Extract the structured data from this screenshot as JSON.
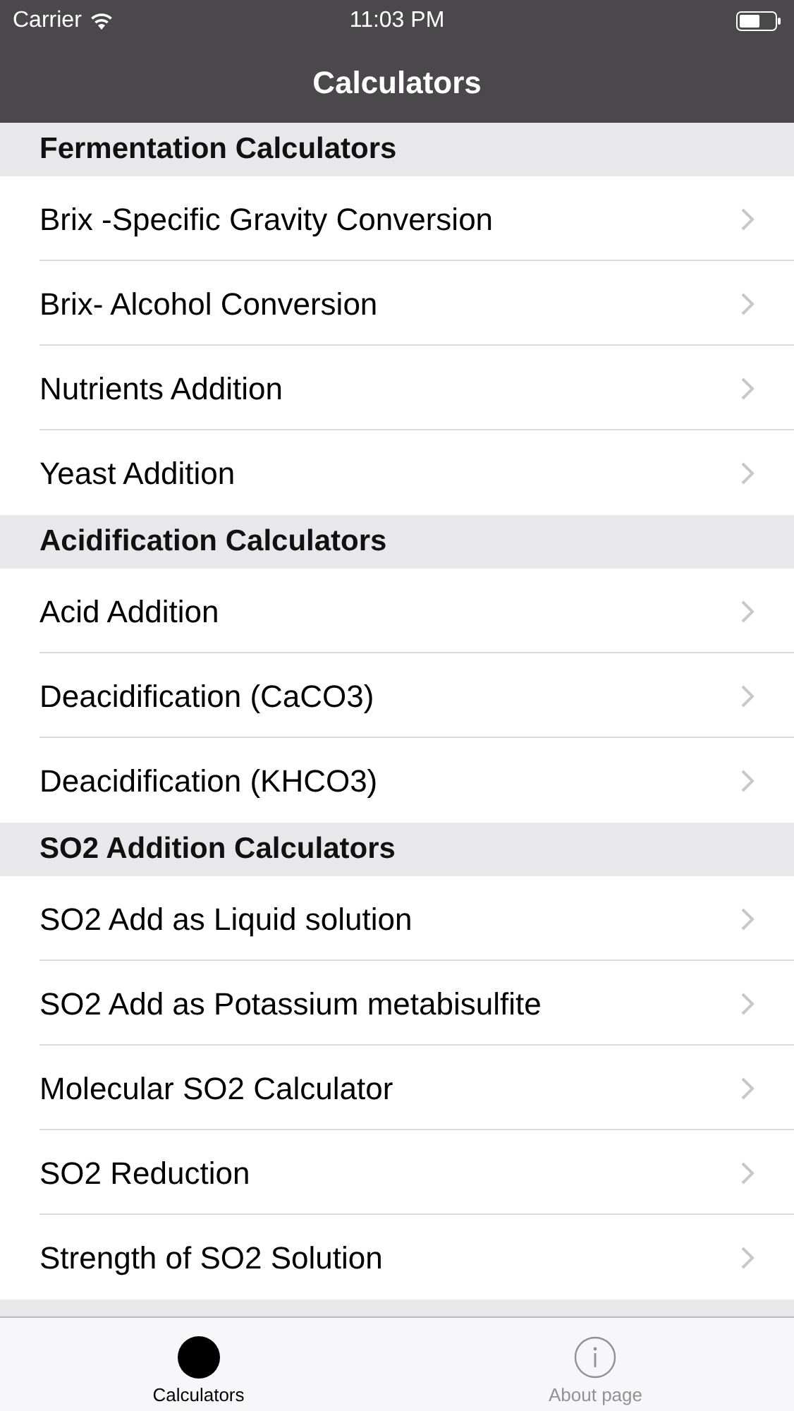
{
  "status_bar": {
    "carrier": "Carrier",
    "time": "11:03 PM"
  },
  "nav_bar": {
    "title": "Calculators"
  },
  "sections": [
    {
      "header": "Fermentation Calculators",
      "items": [
        "Brix -Specific Gravity Conversion",
        "Brix- Alcohol Conversion",
        "Nutrients Addition",
        "Yeast Addition"
      ]
    },
    {
      "header": "Acidification Calculators",
      "items": [
        "Acid Addition",
        "Deacidification (CaCO3)",
        "Deacidification (KHCO3)"
      ]
    },
    {
      "header": "SO2 Addition Calculators",
      "items": [
        "SO2 Add as Liquid solution",
        "SO2 Add as Potassium metabisulfite",
        "Molecular SO2 Calculator",
        "SO2 Reduction",
        "Strength of SO2 Solution"
      ]
    }
  ],
  "tab_bar": [
    {
      "label": "Calculators",
      "kind": "dot",
      "selected": true
    },
    {
      "label": "About page",
      "kind": "info",
      "selected": false
    }
  ]
}
